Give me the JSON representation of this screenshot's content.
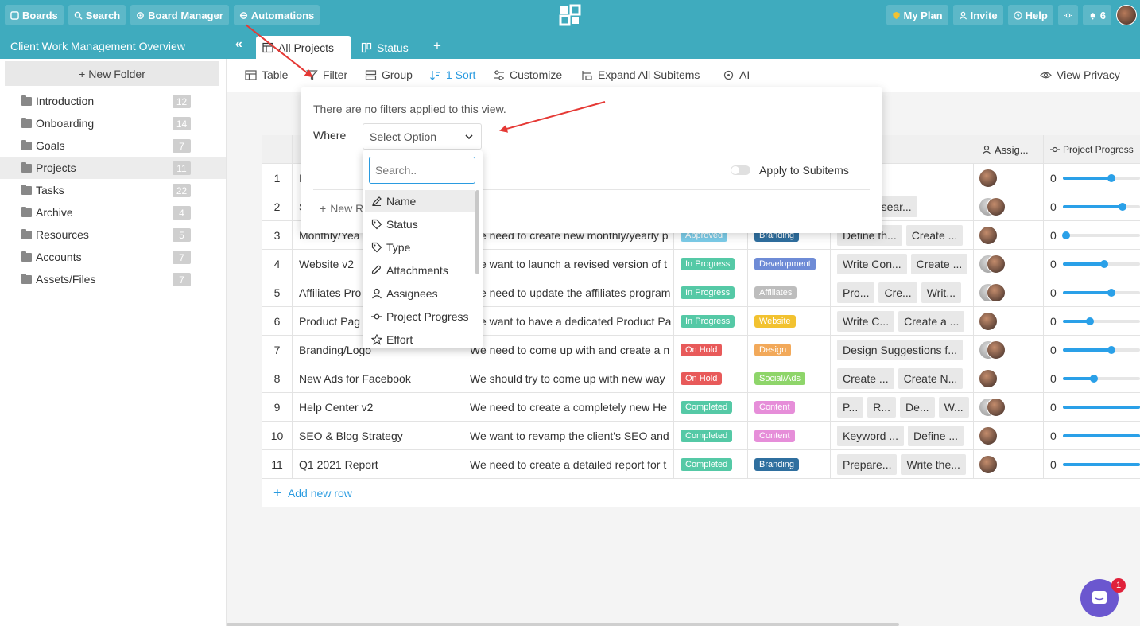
{
  "topbar": {
    "boards": "Boards",
    "search": "Search",
    "board_manager": "Board Manager",
    "automations": "Automations",
    "my_plan": "My Plan",
    "invite": "Invite",
    "help": "Help",
    "notifications": "6"
  },
  "board": {
    "title": "Client Work Management Overview"
  },
  "tabs": [
    {
      "label": "All Projects"
    },
    {
      "label": "Status"
    }
  ],
  "sidebar": {
    "new_folder": "New Folder",
    "folders": [
      {
        "label": "Introduction",
        "count": "12"
      },
      {
        "label": "Onboarding",
        "count": "14"
      },
      {
        "label": "Goals",
        "count": "7"
      },
      {
        "label": "Projects",
        "count": "11"
      },
      {
        "label": "Tasks",
        "count": "22"
      },
      {
        "label": "Archive",
        "count": "4"
      },
      {
        "label": "Resources",
        "count": "5"
      },
      {
        "label": "Accounts",
        "count": "7"
      },
      {
        "label": "Assets/Files",
        "count": "7"
      }
    ]
  },
  "toolbar": {
    "table": "Table",
    "filter": "Filter",
    "group": "Group",
    "sort": "1 Sort",
    "customize": "Customize",
    "expand": "Expand All Subitems",
    "ai": "AI",
    "privacy": "View Privacy"
  },
  "table": {
    "col_assignees": "Assig...",
    "col_progress": "Project Progress",
    "rows": [
      {
        "n": "1",
        "name": "I",
        "desc": "",
        "status": "",
        "type": "",
        "subitems": [],
        "progress_text": "0",
        "progress": 0.63,
        "avatars": 1
      },
      {
        "n": "2",
        "name": "S",
        "desc": "",
        "status": "",
        "type": "",
        "subitems": [
          "...",
          "Resear..."
        ],
        "progress_text": "0",
        "progress": 0.77,
        "avatars": 2
      },
      {
        "n": "3",
        "name": "Monthly/Yea",
        "desc": "We need to create new monthly/yearly p",
        "status": "Approved",
        "status_color": "#7ccde9",
        "type": "Branding",
        "type_color": "#2f6f9f",
        "subitems": [
          "Define th...",
          "Create ..."
        ],
        "progress_text": "0",
        "progress": 0.04,
        "avatars": 1
      },
      {
        "n": "4",
        "name": "Website v2",
        "desc": "We want to launch a revised version of t",
        "status": "In Progress",
        "status_color": "#55c9a6",
        "type": "Development",
        "type_color": "#6e8bd6",
        "subitems": [
          "Write Con...",
          "Create ..."
        ],
        "progress_text": "0",
        "progress": 0.54,
        "avatars": 2
      },
      {
        "n": "5",
        "name": "Affiliates Pro",
        "desc": "We need to update the affiliates program",
        "status": "In Progress",
        "status_color": "#55c9a6",
        "type": "Affiliates",
        "type_color": "#bdbdbd",
        "subitems": [
          "Pro...",
          "Cre...",
          "Writ..."
        ],
        "progress_text": "0",
        "progress": 0.63,
        "avatars": 2
      },
      {
        "n": "6",
        "name": "Product Pag",
        "desc": "We want to have a dedicated Product Pa",
        "status": "In Progress",
        "status_color": "#55c9a6",
        "type": "Website",
        "type_color": "#f2c230",
        "subitems": [
          "Write C...",
          "Create a ..."
        ],
        "progress_text": "0",
        "progress": 0.35,
        "avatars": 1
      },
      {
        "n": "7",
        "name": "Branding/Logo",
        "desc": "We need to come up with and create a n",
        "status": "On Hold",
        "status_color": "#e85a5a",
        "type": "Design",
        "type_color": "#f2a95a",
        "subitems": [
          "Design Suggestions f..."
        ],
        "progress_text": "0",
        "progress": 0.63,
        "avatars": 2
      },
      {
        "n": "8",
        "name": "New Ads for Facebook",
        "desc": "We should try to come up with new way",
        "status": "On Hold",
        "status_color": "#e85a5a",
        "type": "Social/Ads",
        "type_color": "#8ed56a",
        "subitems": [
          "Create ...",
          "Create N..."
        ],
        "progress_text": "0",
        "progress": 0.4,
        "avatars": 1
      },
      {
        "n": "9",
        "name": "Help Center v2",
        "desc": "We need to create a completely new He",
        "status": "Completed",
        "status_color": "#55c9a6",
        "type": "Content",
        "type_color": "#e68ed9",
        "subitems": [
          "P...",
          "R...",
          "De...",
          "W..."
        ],
        "progress_text": "0",
        "progress": 1.0,
        "avatars": 2
      },
      {
        "n": "10",
        "name": "SEO & Blog Strategy",
        "desc": "We want to revamp the client's SEO and",
        "status": "Completed",
        "status_color": "#55c9a6",
        "type": "Content",
        "type_color": "#e68ed9",
        "subitems": [
          "Keyword ...",
          "Define ..."
        ],
        "progress_text": "0",
        "progress": 1.0,
        "avatars": 1
      },
      {
        "n": "11",
        "name": "Q1 2021 Report",
        "desc": "We need to create a detailed report for t",
        "status": "Completed",
        "status_color": "#55c9a6",
        "type": "Branding",
        "type_color": "#2f6f9f",
        "subitems": [
          "Prepare...",
          "Write the..."
        ],
        "progress_text": "0",
        "progress": 1.0,
        "avatars": 1
      }
    ],
    "add_row": "Add new row"
  },
  "filter_popup": {
    "empty_text": "There are no filters applied to this view.",
    "where": "Where",
    "select_placeholder": "Select Option",
    "apply_subitems": "Apply to Subitems",
    "new_rule": "New R"
  },
  "dropdown": {
    "search_placeholder": "Search..",
    "options": [
      "Name",
      "Status",
      "Type",
      "Attachments",
      "Assignees",
      "Project Progress",
      "Effort"
    ]
  },
  "chat": {
    "badge": "1"
  }
}
